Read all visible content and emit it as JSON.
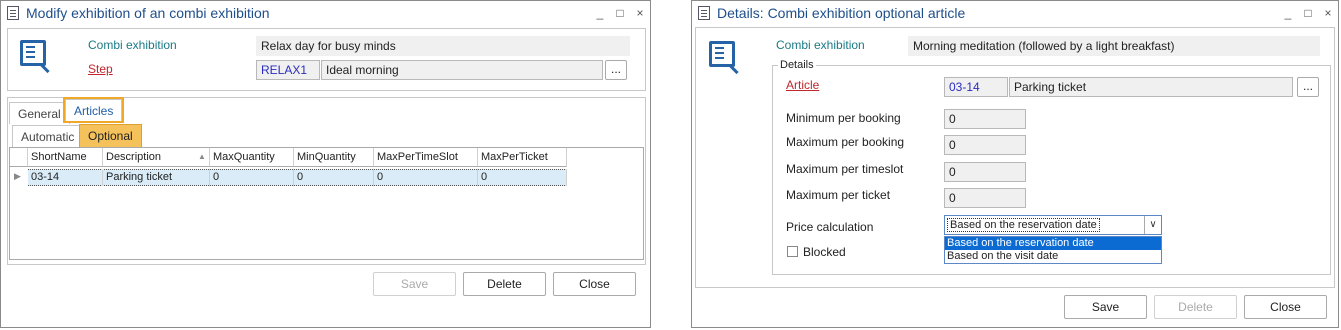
{
  "left": {
    "title": "Modify exhibition of an combi exhibition",
    "title_buttons": [
      "_",
      "□",
      "×"
    ],
    "fields": {
      "combi_label": "Combi exhibition",
      "combi_value": "Relax day for busy minds",
      "step_label": "Step",
      "step_code": "RELAX1",
      "step_value": "Ideal morning",
      "browse": "..."
    },
    "tabs": [
      "General",
      "Articles"
    ],
    "subtabs": [
      "Automatic",
      "Optional"
    ],
    "grid": {
      "columns": [
        "ShortName",
        "Description",
        "MaxQuantity",
        "MinQuantity",
        "MaxPerTimeSlot",
        "MaxPerTicket"
      ],
      "rows": [
        [
          "03-14",
          "Parking ticket",
          "0",
          "0",
          "0",
          "0"
        ]
      ]
    },
    "buttons": {
      "save": "Save",
      "delete": "Delete",
      "close": "Close"
    }
  },
  "right": {
    "title": "Details: Combi exhibition optional article",
    "title_buttons": [
      "_",
      "□",
      "×"
    ],
    "combi_label": "Combi exhibition",
    "combi_value": "Morning meditation (followed by a light breakfast)",
    "group_title": "Details",
    "article_label": "Article",
    "article_code": "03-14",
    "article_value": "Parking ticket",
    "browse": "...",
    "min_booking_label": "Minimum per booking",
    "min_booking_value": "0",
    "max_booking_label": "Maximum per booking",
    "max_booking_value": "0",
    "max_timeslot_label": "Maximum per timeslot",
    "max_timeslot_value": "0",
    "max_ticket_label": "Maximum per ticket",
    "max_ticket_value": "0",
    "price_label": "Price calculation",
    "price_value": "Based on the reservation date",
    "price_options": [
      "Based on the reservation date",
      "Based on the visit date"
    ],
    "blocked_label": "Blocked",
    "buttons": {
      "save": "Save",
      "delete": "Delete",
      "close": "Close"
    }
  }
}
